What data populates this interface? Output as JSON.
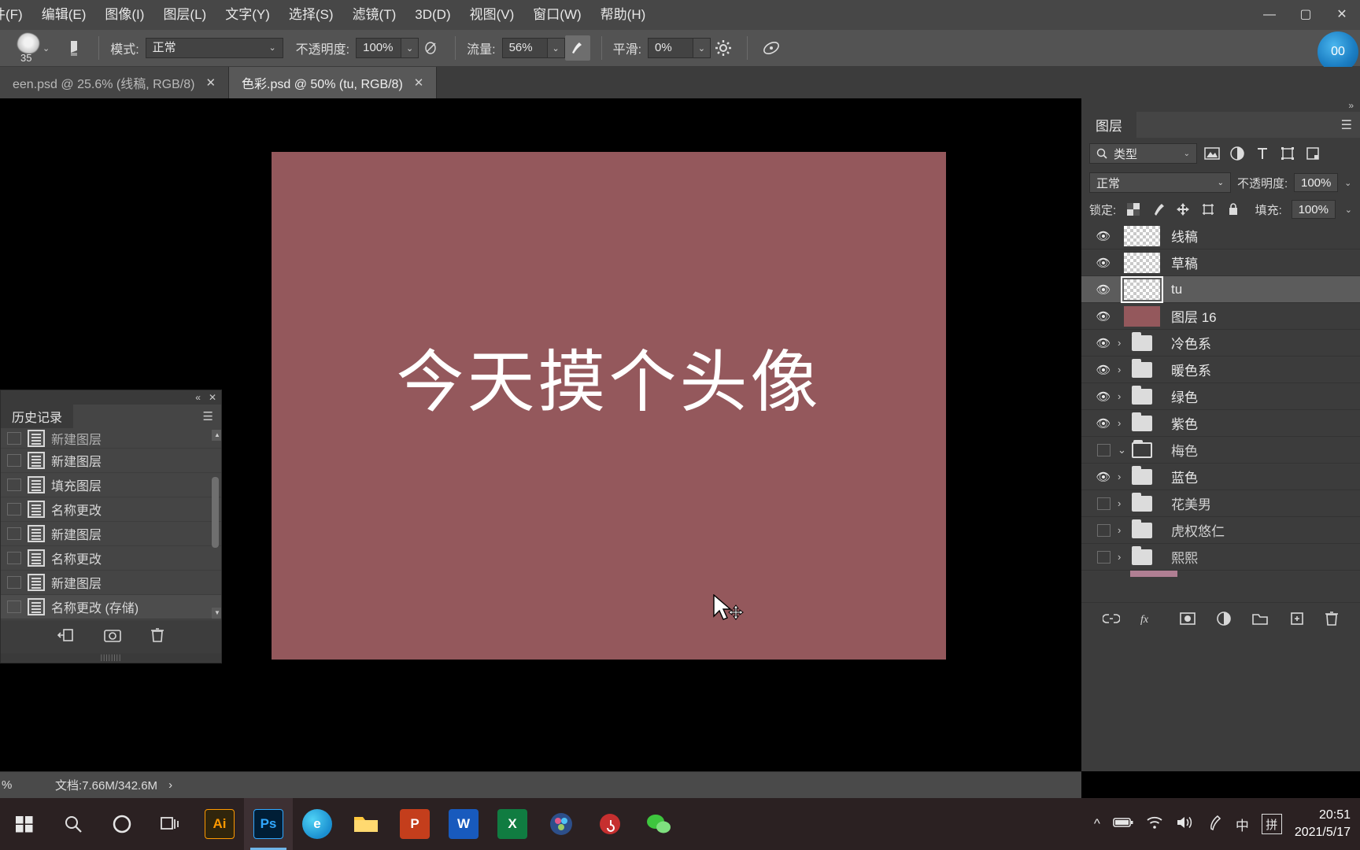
{
  "menu": {
    "items": [
      "件(F)",
      "编辑(E)",
      "图像(I)",
      "图层(L)",
      "文字(Y)",
      "选择(S)",
      "滤镜(T)",
      "3D(D)",
      "视图(V)",
      "窗口(W)",
      "帮助(H)"
    ],
    "window_controls": [
      "—",
      "▢",
      "✕"
    ]
  },
  "options_bar": {
    "brush_size": "35",
    "mode_label": "模式:",
    "mode_value": "正常",
    "opacity_label": "不透明度:",
    "opacity_value": "100%",
    "flow_label": "流量:",
    "flow_value": "56%",
    "smooth_label": "平滑:",
    "smooth_value": "0%",
    "gear_icon": "gear-icon",
    "airbrush_icon": "airbrush-icon",
    "pressure_icon": "pressure-icon",
    "symmetry_icon": "symmetry-icon",
    "search_icon": "search-icon",
    "badge": "00"
  },
  "tabs": [
    {
      "label": "een.psd @ 25.6% (线稿, RGB/8)",
      "close": "✕",
      "active": false
    },
    {
      "label": "色彩.psd @ 50% (tu, RGB/8)",
      "close": "✕",
      "active": true
    }
  ],
  "canvas": {
    "artwork_text": "今天摸个头像",
    "background_color": "#94585c"
  },
  "history_panel": {
    "title": "历史记录",
    "collapse_icon": "chevron-double-left-icon",
    "close_icon": "close-icon",
    "menu_icon": "panel-menu-icon",
    "items": [
      {
        "label": "新建图层",
        "partial": true
      },
      {
        "label": "新建图层",
        "partial": false
      },
      {
        "label": "填充图层",
        "partial": false
      },
      {
        "label": "名称更改",
        "partial": false
      },
      {
        "label": "新建图层",
        "partial": false
      },
      {
        "label": "名称更改",
        "partial": false
      },
      {
        "label": "新建图层",
        "partial": false
      },
      {
        "label": "名称更改 (存储)",
        "partial": false
      }
    ],
    "footer_icons": [
      "create-document-from-state-icon",
      "create-snapshot-icon",
      "delete-state-icon"
    ]
  },
  "status_bar": {
    "zoom": "%",
    "doc_info": "文档:7.66M/342.6M",
    "expand_arrow": "›"
  },
  "layers_panel": {
    "collapse_icon": "chevron-double-right-icon",
    "tab_label": "图层",
    "menu_icon": "panel-menu-icon",
    "filter": {
      "search_icon": "search-icon",
      "kind_label": "类型",
      "chevron": "⌄",
      "icons": [
        "pixel-filter-icon",
        "adjustment-filter-icon",
        "type-filter-icon",
        "shape-filter-icon",
        "smart-object-filter-icon",
        "filter-toggle-icon"
      ]
    },
    "blend_mode": "正常",
    "opacity_label": "不透明度:",
    "opacity_value": "100%",
    "lock_label": "锁定:",
    "lock_icons": [
      "lock-transparent-pixels-icon",
      "lock-image-pixels-icon",
      "lock-position-icon",
      "lock-artboard-icon",
      "lock-all-icon"
    ],
    "fill_label": "填充:",
    "fill_value": "100%",
    "layers": [
      {
        "name": "线稿",
        "visible": true,
        "type": "pixel",
        "selected": false
      },
      {
        "name": "草稿",
        "visible": true,
        "type": "pixel",
        "selected": false
      },
      {
        "name": "tu",
        "visible": true,
        "type": "pixel",
        "selected": true
      },
      {
        "name": "图层 16",
        "visible": true,
        "type": "solid",
        "selected": false
      },
      {
        "name": "冷色系",
        "visible": true,
        "type": "group",
        "expanded": false,
        "selected": false
      },
      {
        "name": "暖色系",
        "visible": true,
        "type": "group",
        "expanded": false,
        "selected": false
      },
      {
        "name": "绿色",
        "visible": true,
        "type": "group",
        "expanded": false,
        "selected": false
      },
      {
        "name": "紫色",
        "visible": true,
        "type": "group",
        "expanded": false,
        "selected": false
      },
      {
        "name": "梅色",
        "visible": false,
        "type": "group",
        "expanded": true,
        "selected": false
      },
      {
        "name": "蓝色",
        "visible": true,
        "type": "group",
        "expanded": false,
        "selected": false
      },
      {
        "name": "花美男",
        "visible": false,
        "type": "group",
        "expanded": false,
        "selected": false
      },
      {
        "name": "虎权悠仁",
        "visible": false,
        "type": "group",
        "expanded": false,
        "selected": false
      },
      {
        "name": "熙熙",
        "visible": false,
        "type": "group",
        "expanded": false,
        "selected": false
      }
    ],
    "footer_icons": [
      "link-layers-icon",
      "layer-style-fx-icon",
      "add-layer-mask-icon",
      "new-adjustment-layer-icon",
      "new-group-icon",
      "new-layer-icon",
      "delete-layer-icon"
    ]
  },
  "taskbar": {
    "start_icon": "windows-start-icon",
    "search_icon": "search-icon",
    "cortana_icon": "cortana-circle-icon",
    "taskview_icon": "task-view-icon",
    "apps": [
      {
        "name": "Ai",
        "label": "Ai",
        "color": "#ff9a00",
        "bg": "#30250c"
      },
      {
        "name": "Ps",
        "label": "Ps",
        "color": "#31a8ff",
        "bg": "#001e36"
      },
      {
        "name": "Edge",
        "label": "e",
        "color": "#ffffff",
        "bg": "#1e8fd0"
      },
      {
        "name": "Explorer",
        "label": "",
        "color": "#ffc83d",
        "bg": "#ffc83d"
      },
      {
        "name": "PowerPoint",
        "label": "P",
        "color": "#ffffff",
        "bg": "#c43e1c"
      },
      {
        "name": "Word",
        "label": "W",
        "color": "#ffffff",
        "bg": "#185abd"
      },
      {
        "name": "Excel",
        "label": "X",
        "color": "#ffffff",
        "bg": "#107c41"
      },
      {
        "name": "DaVinci",
        "label": "",
        "color": "#ffffff",
        "bg": "#3b5b9a"
      },
      {
        "name": "NetEase Music",
        "label": "",
        "color": "#ffffff",
        "bg": "#c62f2f"
      },
      {
        "name": "WeChat",
        "label": "",
        "color": "#ffffff",
        "bg": "#2dc100"
      }
    ],
    "tray": {
      "up_arrow": "^",
      "battery_icon": "battery-icon",
      "wifi_icon": "wifi-icon",
      "volume_icon": "volume-icon",
      "pen_icon": "pen-icon",
      "ime_mode": "中",
      "ime_pinyin": "拼",
      "time": "20:51",
      "date": "2021/5/17"
    }
  }
}
